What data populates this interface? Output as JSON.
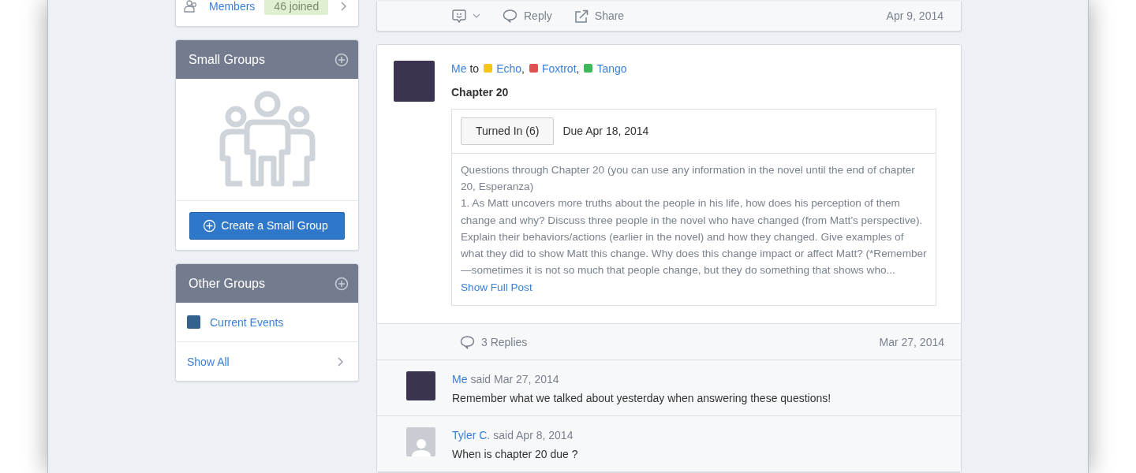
{
  "sidebar": {
    "members": {
      "label": "Members",
      "badge": "46 joined"
    },
    "small_groups": {
      "title": "Small Groups",
      "button": "Create a Small Group"
    },
    "other_groups": {
      "title": "Other Groups",
      "items": [
        {
          "label": "Current Events",
          "color": "#33628f"
        }
      ],
      "show_all": "Show All"
    }
  },
  "previous_post_footer": {
    "actions": [
      {
        "kind": "reaction"
      },
      {
        "kind": "reply",
        "label": "Reply"
      },
      {
        "kind": "share",
        "label": "Share"
      }
    ],
    "date": "Apr 9, 2014"
  },
  "post": {
    "author": "Me",
    "to": "to",
    "recipients": [
      {
        "name": "Echo",
        "color": "#f5c518",
        "separator": ","
      },
      {
        "name": "Foxtrot",
        "color": "#e05252",
        "separator": ","
      },
      {
        "name": "Tango",
        "color": "#3dbb5a"
      }
    ],
    "title": "Chapter 20",
    "assignment": {
      "button": "Turned In (6)",
      "due": "Due Apr 18, 2014",
      "text": [
        "Questions through Chapter 20 (you can use any information in the novel until the end of chapter 20, Esperanza)",
        "1. As Matt uncovers more truths about the people in his life, how does his perception of them change and why? Discuss three people in the novel who have changed (from Matt’s perspective). Explain their behaviors/actions (earlier in the novel) and how they changed. Give examples of what they did to show Matt this change. Why does this change impact or affect Matt? (*Remember—sometimes it is not so much that people change, but they do something that shows who..."
      ],
      "more_link": "Show Full Post"
    },
    "footer": {
      "replies": "3 Replies",
      "date": "Mar 27, 2014"
    },
    "comments": [
      {
        "kind": "photo",
        "author": "Me",
        "said": "said Mar 27, 2014",
        "text": "Remember what we talked about yesterday when answering these questions!"
      },
      {
        "kind": "placeholder",
        "author": "Tyler C.",
        "said": "said Apr 8, 2014",
        "text": "When is chapter 20 due ?"
      }
    ]
  }
}
